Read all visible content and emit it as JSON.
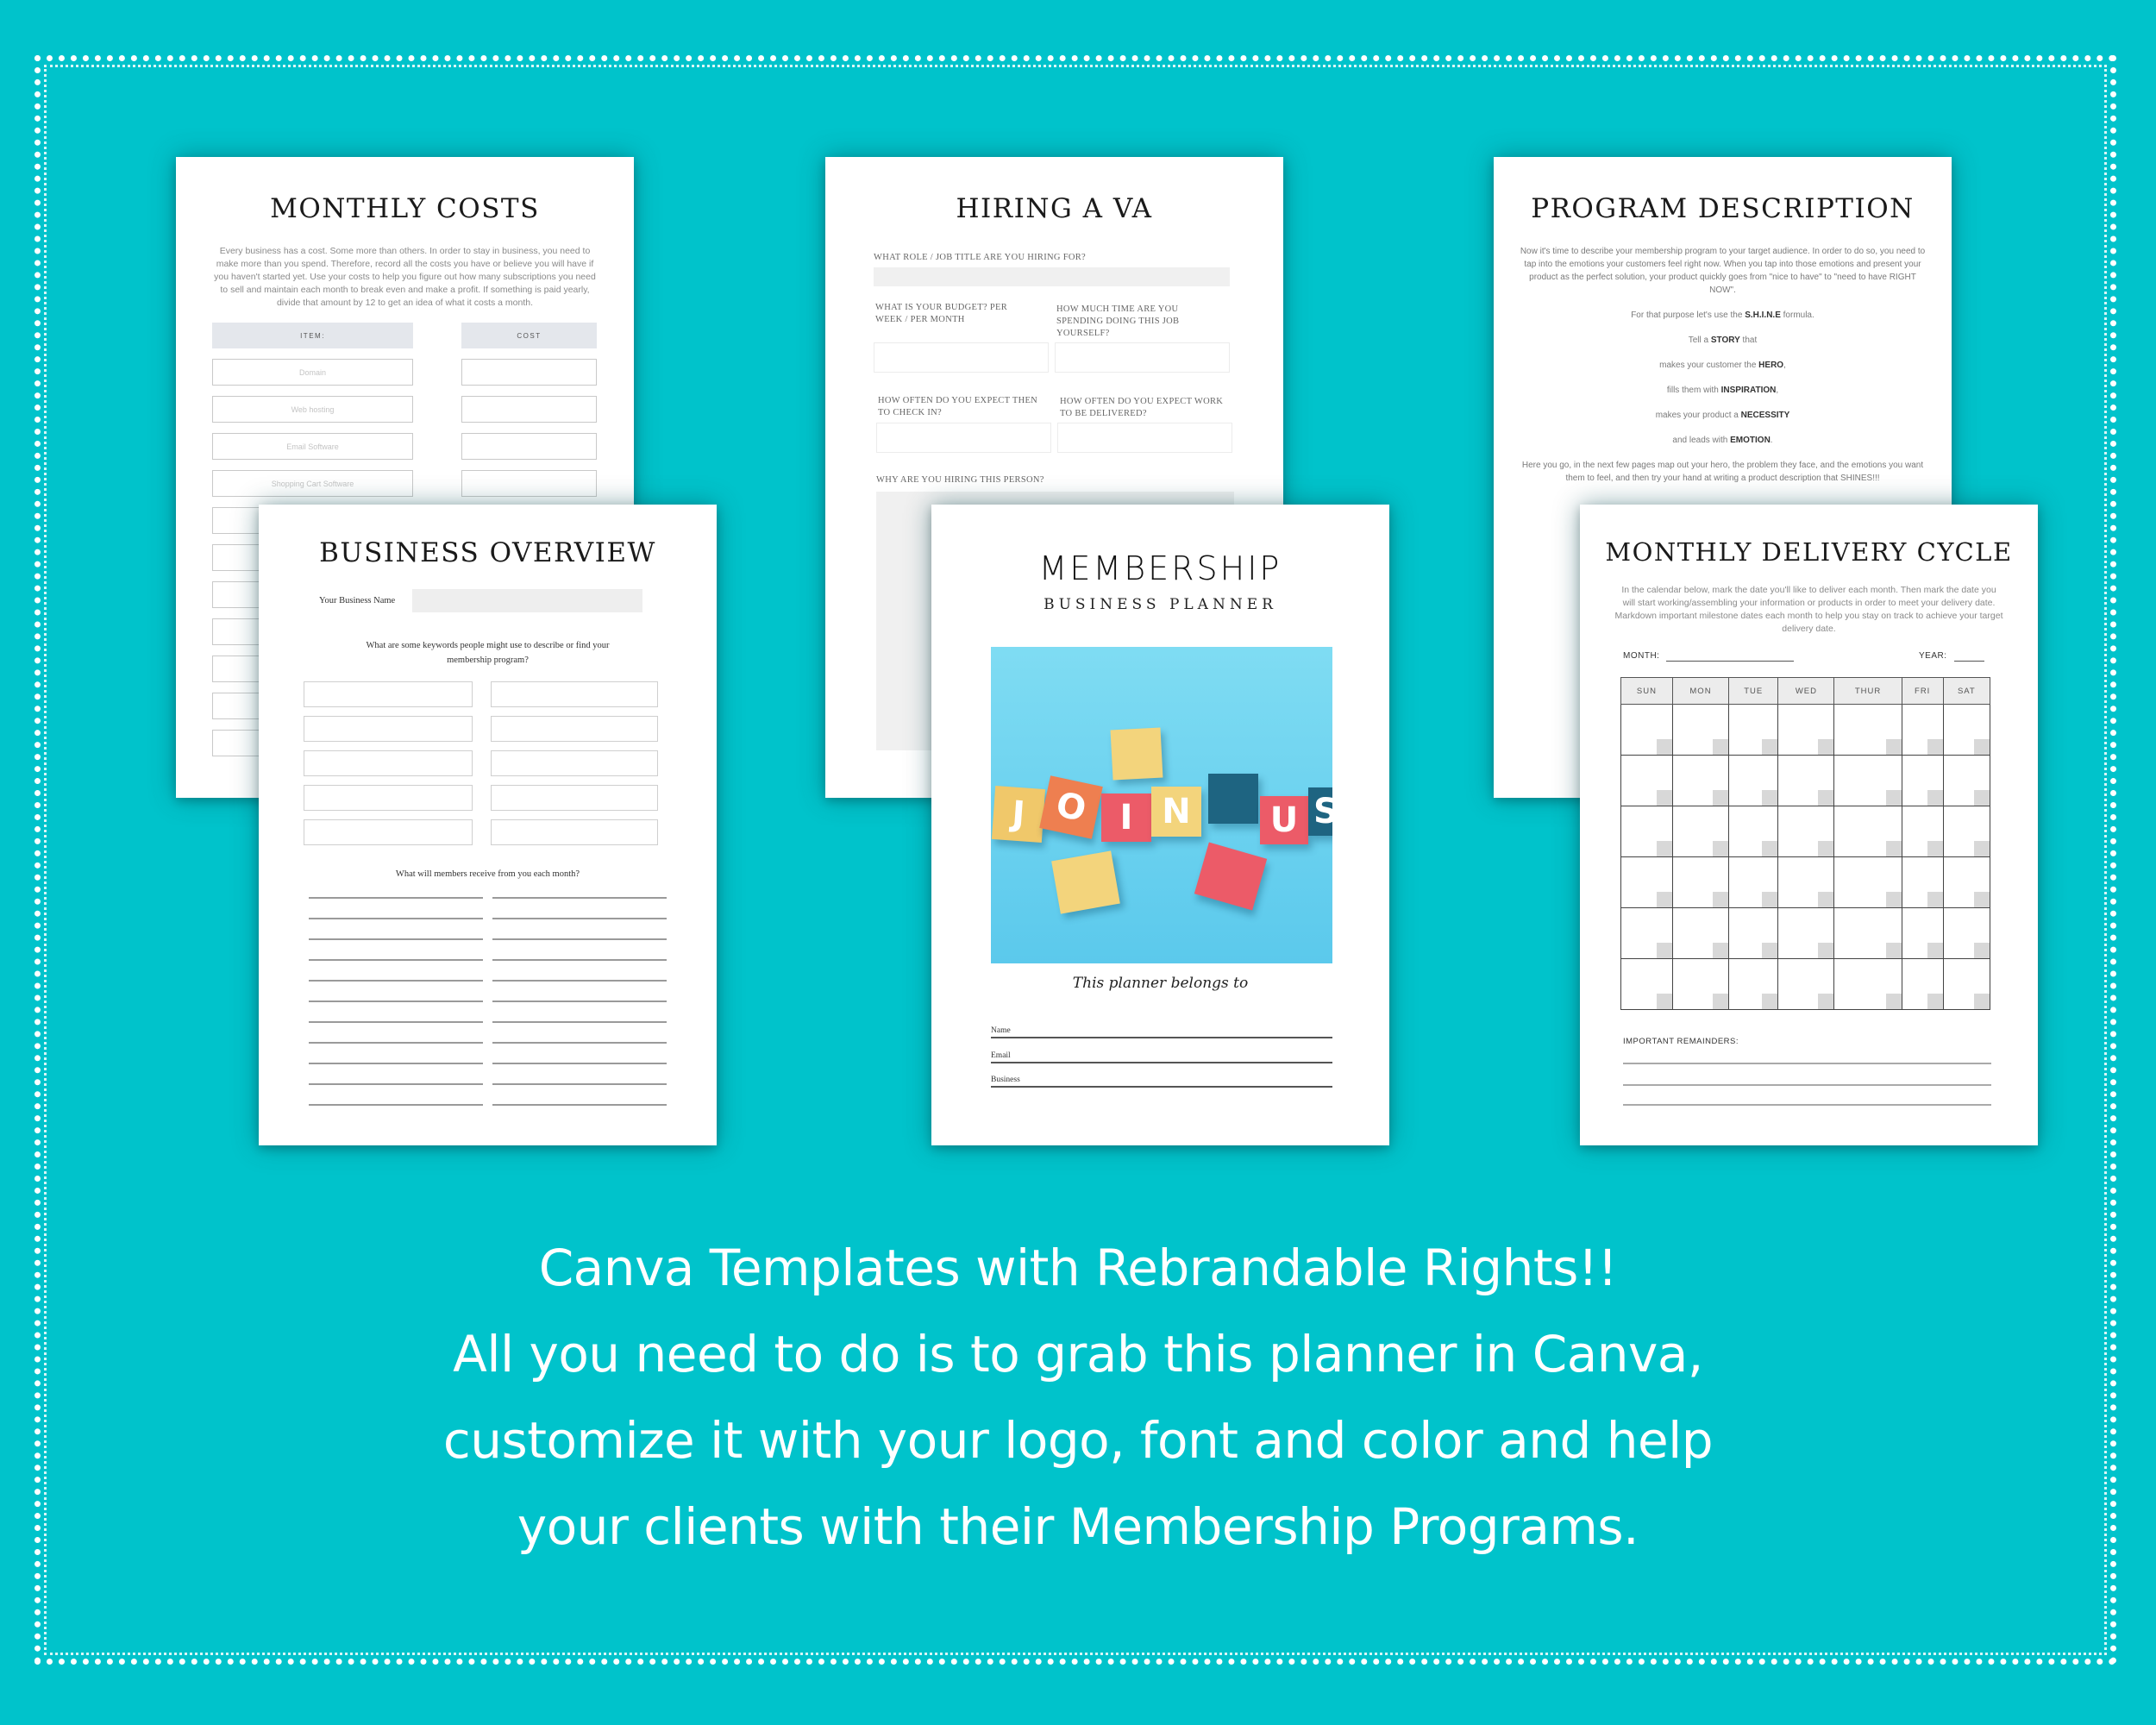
{
  "background_color": "#00c3cb",
  "pages": {
    "monthly_costs": {
      "title": "MONTHLY COSTS",
      "description": "Every business has a cost. Some more than others. In order to stay in business, you need to make more than you spend. Therefore, record all the costs you have or believe you will have if you haven't started yet. Use your costs to help you figure out how many subscriptions you need to sell and maintain each month to break even and make a profit. If something is paid yearly, divide that amount by 12 to get an idea of what it costs a month.",
      "col_item": "ITEM:",
      "col_cost": "COST",
      "rows": [
        "Domain",
        "Web hosting",
        "Email Software",
        "Shopping Cart Software",
        "",
        "",
        "",
        "",
        "",
        "",
        ""
      ]
    },
    "hiring_va": {
      "title": "HIRING A VA",
      "q_role": "WHAT ROLE / JOB TITLE ARE YOU HIRING FOR?",
      "q_budget": "WHAT IS YOUR BUDGET? PER WEEK / PER MONTH",
      "q_time": "HOW MUCH TIME ARE YOU SPENDING DOING THIS JOB YOURSELF?",
      "q_checkin": "HOW OFTEN DO YOU EXPECT THEN TO CHECK IN?",
      "q_delivered": "HOW OFTEN DO YOU EXPECT WORK TO BE DELIVERED?",
      "q_why": "WHY ARE YOU HIRING THIS PERSON?"
    },
    "program_description": {
      "title": "PROGRAM DESCRIPTION",
      "intro": "Now it's time to describe your membership program to your target audience. In order to do so, you need to tap into the emotions your customers feel right now. When you tap into those emotions and present your product as the perfect solution, your product quickly goes from \"nice to have\" to \"need to have RIGHT NOW\".",
      "formula_pre": "For that purpose let's use the ",
      "formula_bold": "S.H.I.N.E",
      "formula_post": " formula.",
      "steps": [
        {
          "pre": "Tell a ",
          "bold": "STORY",
          "post": " that"
        },
        {
          "pre": "makes your customer the ",
          "bold": "HERO",
          "post": ","
        },
        {
          "pre": "fills them with ",
          "bold": "INSPIRATION",
          "post": ","
        },
        {
          "pre": "makes your product a ",
          "bold": "NECESSITY",
          "post": ""
        },
        {
          "pre": "and leads with ",
          "bold": "EMOTION",
          "post": "."
        }
      ],
      "outro": "Here you go, in the next few pages map out your hero, the problem they face, and the emotions you want them to feel, and then try your hand at writing a product description that SHINES!!!"
    },
    "business_overview": {
      "title": "BUSINESS OVERVIEW",
      "name_label": "Your Business Name",
      "keywords_q": "What are some keywords people might use to describe or find your membership program?",
      "receive_q": "What will members receive from you each month?"
    },
    "cover": {
      "title": "MEMBERSHIP",
      "subtitle": "BUSINESS PLANNER",
      "image_blocks": [
        "J",
        "O",
        "I",
        "N",
        "U",
        "S"
      ],
      "belongs": "This planner belongs to",
      "fields": [
        "Name",
        "Email",
        "Business"
      ]
    },
    "delivery_cycle": {
      "title": "MONTHLY DELIVERY CYCLE",
      "description": "In the calendar below, mark the date you'll like to deliver each month. Then mark the date you will start working/assembling your information or products in order to meet your delivery date. Markdown important milestone dates each month to help you stay on track to achieve your target delivery date.",
      "month_label": "MONTH:",
      "year_label": "YEAR:",
      "days": [
        "SUN",
        "MON",
        "TUE",
        "WED",
        "THUR",
        "FRI",
        "SAT"
      ],
      "weeks": 6,
      "reminders_label": "IMPORTANT REMAINDERS:"
    }
  },
  "caption": {
    "lines": [
      "Canva Templates with Rebrandable Rights!!",
      "All you need to do is to grab this planner in Canva,",
      "customize it with your logo, font and color and help",
      "your clients with their Membership Programs."
    ]
  }
}
